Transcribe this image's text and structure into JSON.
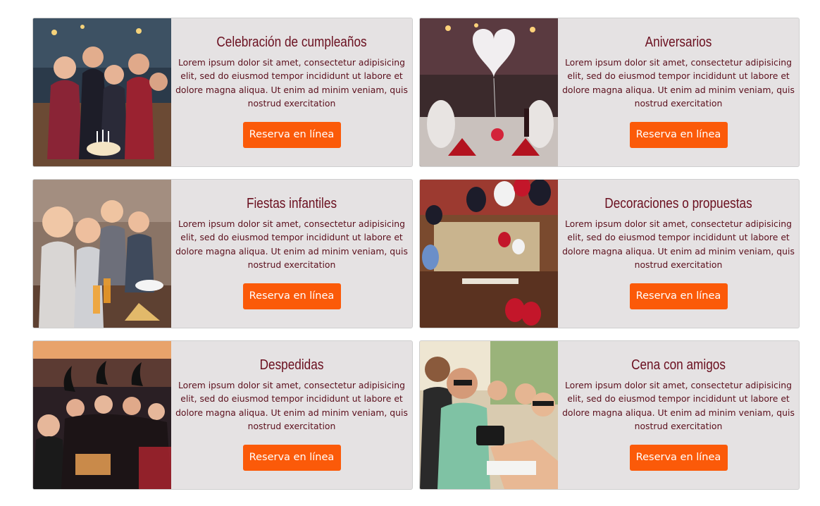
{
  "cards": [
    {
      "title": "Celebración de cumpleaños",
      "description": "Lorem ipsum dolor sit amet, consectetur adipisicing elit, sed do eiusmod tempor incididunt ut labore et dolore magna aliqua. Ut enim ad minim veniam, quis nostrud exercitation",
      "button_label": "Reserva en línea",
      "image": "birthday-party-photo"
    },
    {
      "title": "Aniversarios",
      "description": "Lorem ipsum dolor sit amet, consectetur adipisicing elit, sed do eiusmod tempor incididunt ut labore et dolore magna aliqua. Ut enim ad minim veniam, quis nostrud exercitation",
      "button_label": "Reserva en línea",
      "image": "anniversary-dinner-photo"
    },
    {
      "title": "Fiestas infantiles",
      "description": "Lorem ipsum dolor sit amet, consectetur adipisicing elit, sed do eiusmod tempor incididunt ut labore et dolore magna aliqua. Ut enim ad minim veniam, quis nostrud exercitation",
      "button_label": "Reserva en línea",
      "image": "kids-party-photo"
    },
    {
      "title": "Decoraciones o propuestas",
      "description": "Lorem ipsum dolor sit amet, consectetur adipisicing elit, sed do eiusmod tempor incididunt ut labore et dolore magna aliqua. Ut enim ad minim veniam, quis nostrud exercitation",
      "button_label": "Reserva en línea",
      "image": "balloon-decorations-photo"
    },
    {
      "title": "Despedidas",
      "description": "Lorem ipsum dolor sit amet, consectetur adipisicing elit, sed do eiusmod tempor incididunt ut labore et dolore magna aliqua. Ut enim ad minim veniam, quis nostrud exercitation",
      "button_label": "Reserva en línea",
      "image": "farewell-party-photo"
    },
    {
      "title": "Cena con amigos",
      "description": "Lorem ipsum dolor sit amet, consectetur adipisicing elit, sed do eiusmod tempor incididunt ut labore et dolore magna aliqua. Ut enim ad minim veniam, quis nostrud exercitation",
      "button_label": "Reserva en línea",
      "image": "friends-dinner-selfie-photo"
    }
  ],
  "colors": {
    "card_background": "#e5e2e3",
    "title": "#6a0f1f",
    "text": "#5b0f1c",
    "button": "#fb5a09"
  }
}
